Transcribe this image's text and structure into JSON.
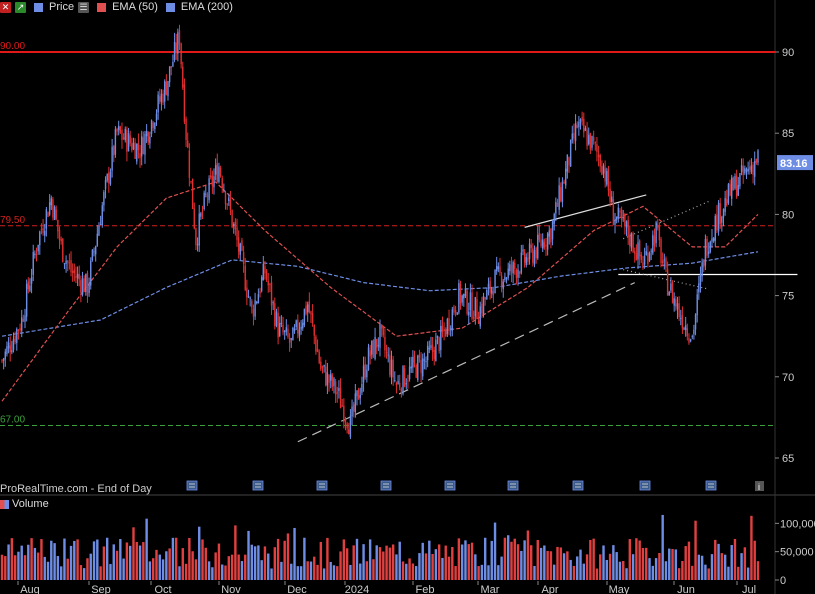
{
  "legend": {
    "price_label": "Price",
    "ema50_label": "EMA (50)",
    "ema200_label": "EMA (200)",
    "colors": {
      "price": "#6e8ee6",
      "ema50": "#e05050",
      "ema200": "#6e8ee6"
    }
  },
  "watermark": "ProRealTime.com - End of Day",
  "volume_label": "Volume",
  "last_price": "83.16",
  "chart_data": [
    {
      "type": "candlestick",
      "title": "",
      "x": [
        "Aug",
        "Sep",
        "Oct",
        "Nov",
        "Dec",
        "2024",
        "Feb",
        "Mar",
        "Apr",
        "May",
        "Jun",
        "Jul"
      ],
      "yticks": [
        "65",
        "70",
        "75",
        "80",
        "85",
        "90"
      ],
      "ylim": [
        63.5,
        92
      ],
      "price_trend": [
        [
          0,
          71
        ],
        [
          12,
          73.5
        ],
        [
          22,
          78.5
        ],
        [
          30,
          81
        ],
        [
          36,
          78
        ],
        [
          42,
          76.5
        ],
        [
          52,
          75.5
        ],
        [
          60,
          80
        ],
        [
          70,
          85
        ],
        [
          84,
          84
        ],
        [
          100,
          88
        ],
        [
          108,
          91
        ],
        [
          112,
          85
        ],
        [
          118,
          78.5
        ],
        [
          124,
          81
        ],
        [
          132,
          83
        ],
        [
          138,
          80.5
        ],
        [
          146,
          77
        ],
        [
          152,
          74
        ],
        [
          160,
          76.5
        ],
        [
          168,
          73
        ],
        [
          176,
          72
        ],
        [
          186,
          74.5
        ],
        [
          194,
          70.5
        ],
        [
          204,
          69
        ],
        [
          212,
          67
        ],
        [
          222,
          71
        ],
        [
          230,
          72.5
        ],
        [
          240,
          69.5
        ],
        [
          250,
          70.5
        ],
        [
          258,
          71
        ],
        [
          268,
          72.5
        ],
        [
          278,
          75
        ],
        [
          290,
          74
        ],
        [
          300,
          76
        ],
        [
          310,
          76.5
        ],
        [
          322,
          77.5
        ],
        [
          334,
          79
        ],
        [
          344,
          83
        ],
        [
          350,
          85.5
        ],
        [
          358,
          84.5
        ],
        [
          366,
          83
        ],
        [
          372,
          80
        ],
        [
          380,
          79
        ],
        [
          390,
          77
        ],
        [
          398,
          79
        ],
        [
          404,
          76
        ],
        [
          412,
          74
        ],
        [
          420,
          72.5
        ],
        [
          428,
          78
        ],
        [
          436,
          80
        ],
        [
          444,
          81.5
        ],
        [
          452,
          82.5
        ],
        [
          460,
          83.5
        ]
      ],
      "ema50": [
        [
          0,
          68.5
        ],
        [
          40,
          74
        ],
        [
          70,
          78
        ],
        [
          100,
          81
        ],
        [
          130,
          82
        ],
        [
          160,
          79
        ],
        [
          200,
          75.5
        ],
        [
          240,
          72.5
        ],
        [
          280,
          73
        ],
        [
          320,
          75.5
        ],
        [
          360,
          79
        ],
        [
          390,
          80.5
        ],
        [
          420,
          78
        ],
        [
          440,
          78
        ],
        [
          460,
          80
        ]
      ],
      "ema200": [
        [
          0,
          72.5
        ],
        [
          60,
          73.5
        ],
        [
          100,
          75.5
        ],
        [
          140,
          77.2
        ],
        [
          180,
          76.8
        ],
        [
          220,
          75.8
        ],
        [
          260,
          75.3
        ],
        [
          300,
          75.5
        ],
        [
          340,
          76.2
        ],
        [
          380,
          76.7
        ],
        [
          420,
          77
        ],
        [
          460,
          77.7
        ]
      ],
      "horizontal_levels": [
        {
          "label": "90.00",
          "value": 90,
          "color": "#e01818",
          "style": "solid"
        },
        {
          "label": "79.50",
          "value": 79.3,
          "color": "#d02020",
          "style": "dashed"
        },
        {
          "label": "67.00",
          "value": 67,
          "color": "#3aa03a",
          "style": "dashed"
        }
      ],
      "volume_axis": {
        "ticks": [
          "0",
          "50,000",
          "100,000"
        ],
        "ylim": [
          0,
          120000
        ]
      }
    }
  ]
}
